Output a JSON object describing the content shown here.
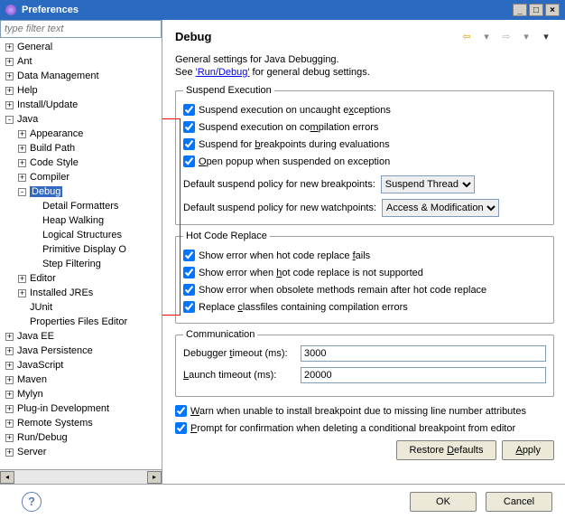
{
  "window": {
    "title": "Preferences"
  },
  "filter": {
    "placeholder": "type filter text"
  },
  "tree": [
    {
      "label": "General",
      "depth": 0,
      "exp": "+"
    },
    {
      "label": "Ant",
      "depth": 0,
      "exp": "+"
    },
    {
      "label": "Data Management",
      "depth": 0,
      "exp": "+"
    },
    {
      "label": "Help",
      "depth": 0,
      "exp": "+"
    },
    {
      "label": "Install/Update",
      "depth": 0,
      "exp": "+"
    },
    {
      "label": "Java",
      "depth": 0,
      "exp": "-"
    },
    {
      "label": "Appearance",
      "depth": 1,
      "exp": "+"
    },
    {
      "label": "Build Path",
      "depth": 1,
      "exp": "+"
    },
    {
      "label": "Code Style",
      "depth": 1,
      "exp": "+"
    },
    {
      "label": "Compiler",
      "depth": 1,
      "exp": "+"
    },
    {
      "label": "Debug",
      "depth": 1,
      "exp": "-",
      "selected": true
    },
    {
      "label": "Detail Formatters",
      "depth": 2,
      "exp": ""
    },
    {
      "label": "Heap Walking",
      "depth": 2,
      "exp": ""
    },
    {
      "label": "Logical Structures",
      "depth": 2,
      "exp": ""
    },
    {
      "label": "Primitive Display O",
      "depth": 2,
      "exp": ""
    },
    {
      "label": "Step Filtering",
      "depth": 2,
      "exp": ""
    },
    {
      "label": "Editor",
      "depth": 1,
      "exp": "+"
    },
    {
      "label": "Installed JREs",
      "depth": 1,
      "exp": "+"
    },
    {
      "label": "JUnit",
      "depth": 1,
      "exp": ""
    },
    {
      "label": "Properties Files Editor",
      "depth": 1,
      "exp": ""
    },
    {
      "label": "Java EE",
      "depth": 0,
      "exp": "+"
    },
    {
      "label": "Java Persistence",
      "depth": 0,
      "exp": "+"
    },
    {
      "label": "JavaScript",
      "depth": 0,
      "exp": "+"
    },
    {
      "label": "Maven",
      "depth": 0,
      "exp": "+"
    },
    {
      "label": "Mylyn",
      "depth": 0,
      "exp": "+"
    },
    {
      "label": "Plug-in Development",
      "depth": 0,
      "exp": "+"
    },
    {
      "label": "Remote Systems",
      "depth": 0,
      "exp": "+"
    },
    {
      "label": "Run/Debug",
      "depth": 0,
      "exp": "+"
    },
    {
      "label": "Server",
      "depth": 0,
      "exp": "+"
    }
  ],
  "heading": "Debug",
  "desc": "General settings for Java Debugging.",
  "seeLine": {
    "prefix": "See ",
    "link": "'Run/Debug'",
    "suffix": " for general debug settings."
  },
  "suspend": {
    "legend": "Suspend Execution",
    "c1_pre": "Suspend execution on uncaught e",
    "c1_u": "x",
    "c1_post": "ceptions",
    "c2_pre": "Suspend execution on co",
    "c2_u": "m",
    "c2_post": "pilation errors",
    "c3_pre": "Suspend for ",
    "c3_u": "b",
    "c3_post": "reakpoints during evaluations",
    "c4_pre": "",
    "c4_u": "O",
    "c4_post": "pen popup when suspended on exception",
    "policy1_label": "Default suspend policy for new breakpoints:",
    "policy1_value": "Suspend Thread",
    "policy2_label": "Default suspend policy for new watchpoints:",
    "policy2_value": "Access & Modification"
  },
  "hotcode": {
    "legend": "Hot Code Replace",
    "c1_pre": "Show error when hot code replace ",
    "c1_u": "f",
    "c1_post": "ails",
    "c2_pre": "Show error when ",
    "c2_u": "h",
    "c2_post": "ot code replace is not supported",
    "c3": "Show error when obsolete methods remain after hot code replace",
    "c4_pre": "Replace ",
    "c4_u": "c",
    "c4_post": "lassfiles containing compilation errors"
  },
  "comm": {
    "legend": "Communication",
    "t1_pre": "Debugger ",
    "t1_u": "t",
    "t1_post": "imeout (ms):",
    "t1_val": "3000",
    "t2_pre": "",
    "t2_u": "L",
    "t2_post": "aunch timeout (ms):",
    "t2_val": "20000"
  },
  "bottom": {
    "b1_pre": "",
    "b1_u": "W",
    "b1_post": "arn when unable to install breakpoint due to missing line number attributes",
    "b2_pre": "",
    "b2_u": "P",
    "b2_post": "rompt for confirmation when deleting a conditional breakpoint from editor"
  },
  "buttons": {
    "restore_u": "D",
    "restore_pre": "Restore ",
    "restore_post": "efaults",
    "apply_u": "A",
    "apply_post": "pply",
    "ok": "OK",
    "cancel": "Cancel"
  }
}
